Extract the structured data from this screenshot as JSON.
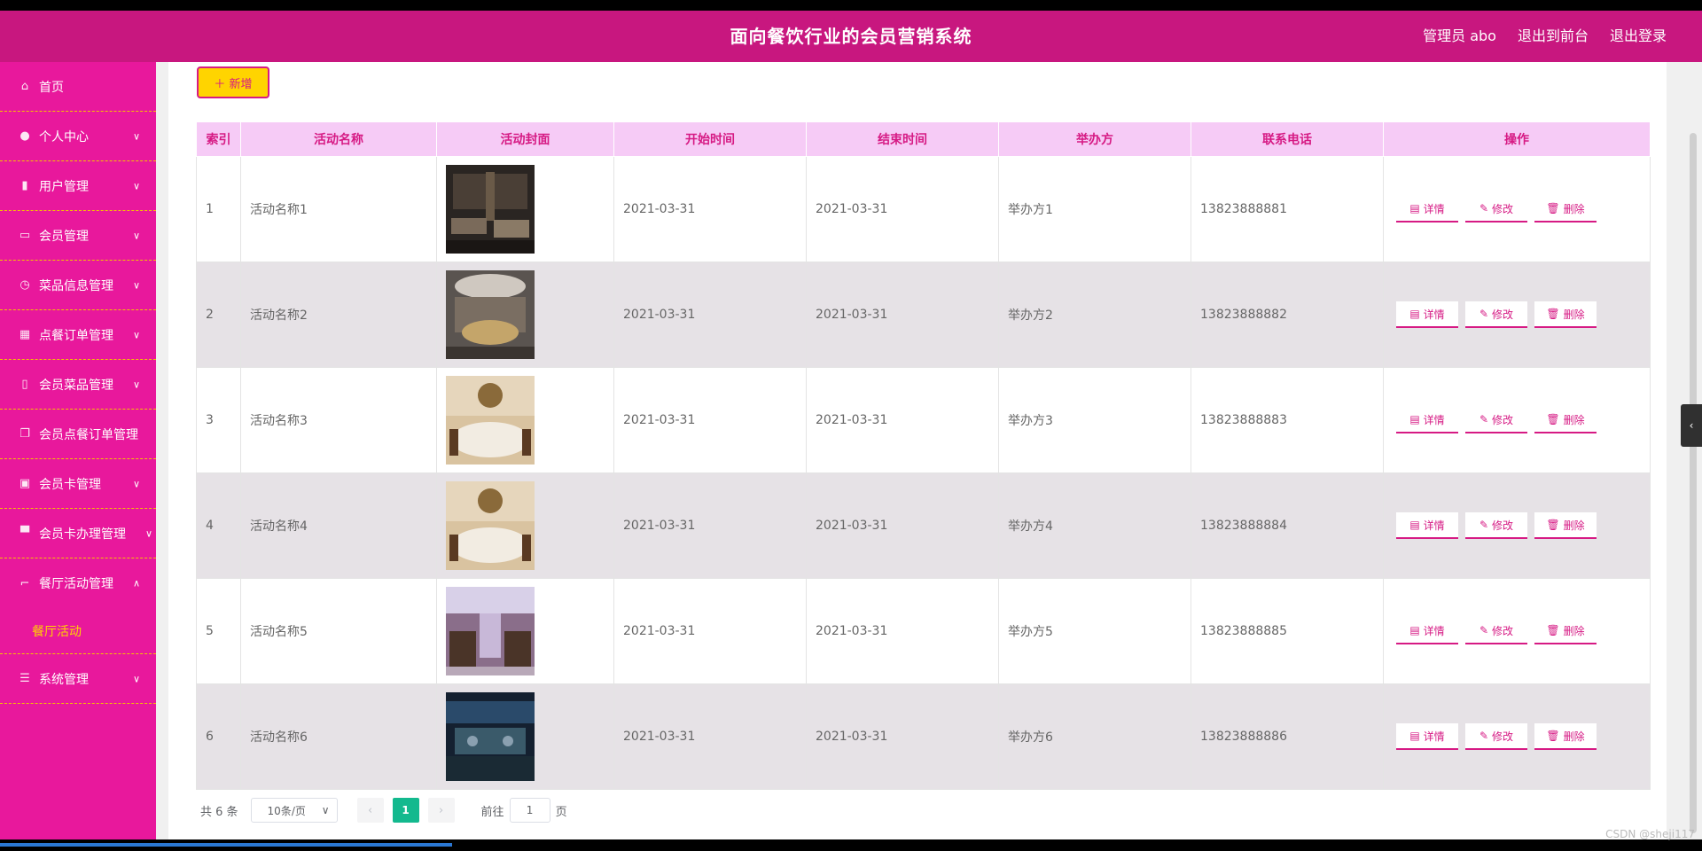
{
  "header": {
    "title": "面向餐饮行业的会员营销系统",
    "user": "管理员 abo",
    "to_front": "退出到前台",
    "logout": "退出登录"
  },
  "sidebar": {
    "items": [
      {
        "label": "首页",
        "icon": "home-icon"
      },
      {
        "label": "个人中心",
        "icon": "user-icon"
      },
      {
        "label": "用户管理",
        "icon": "thumb-icon"
      },
      {
        "label": "会员管理",
        "icon": "chat-icon"
      },
      {
        "label": "菜品信息管理",
        "icon": "clock-icon"
      },
      {
        "label": "点餐订单管理",
        "icon": "grid-icon"
      },
      {
        "label": "会员菜品管理",
        "icon": "phone-icon"
      },
      {
        "label": "会员点餐订单管理",
        "icon": "copy-icon"
      },
      {
        "label": "会员卡管理",
        "icon": "clipboard-icon"
      },
      {
        "label": "会员卡办理管理",
        "icon": "stand-icon"
      },
      {
        "label": "餐厅活动管理",
        "icon": "crop-icon"
      }
    ],
    "sub_item": "餐厅活动",
    "last_item": {
      "label": "系统管理",
      "icon": "menu-icon"
    }
  },
  "toolbar": {
    "add_label": "＋ 新增"
  },
  "table": {
    "headers": [
      "索引",
      "活动名称",
      "活动封面",
      "开始时间",
      "结束时间",
      "举办方",
      "联系电话",
      "操作"
    ],
    "rows": [
      {
        "index": "1",
        "name": "活动名称1",
        "start": "2021-03-31",
        "end": "2021-03-31",
        "host": "举办方1",
        "phone": "13823888881"
      },
      {
        "index": "2",
        "name": "活动名称2",
        "start": "2021-03-31",
        "end": "2021-03-31",
        "host": "举办方2",
        "phone": "13823888882"
      },
      {
        "index": "3",
        "name": "活动名称3",
        "start": "2021-03-31",
        "end": "2021-03-31",
        "host": "举办方3",
        "phone": "13823888883"
      },
      {
        "index": "4",
        "name": "活动名称4",
        "start": "2021-03-31",
        "end": "2021-03-31",
        "host": "举办方4",
        "phone": "13823888884"
      },
      {
        "index": "5",
        "name": "活动名称5",
        "start": "2021-03-31",
        "end": "2021-03-31",
        "host": "举办方5",
        "phone": "13823888885"
      },
      {
        "index": "6",
        "name": "活动名称6",
        "start": "2021-03-31",
        "end": "2021-03-31",
        "host": "举办方6",
        "phone": "13823888886"
      }
    ],
    "ops": {
      "detail": "详情",
      "edit": "修改",
      "delete": "删除"
    }
  },
  "pagination": {
    "total": "共 6 条",
    "page_size": "10条/页",
    "current": "1",
    "goto_label": "前往",
    "goto_value": "1",
    "page_unit": "页"
  },
  "watermark": "CSDN @sheji117"
}
